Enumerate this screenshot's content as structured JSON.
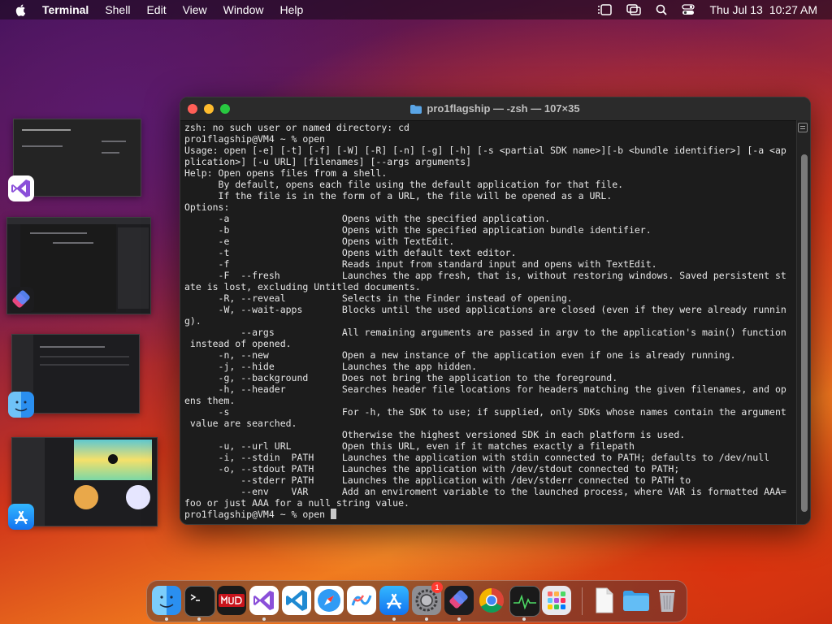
{
  "menubar": {
    "app_name": "Terminal",
    "items": [
      "Shell",
      "Edit",
      "View",
      "Window",
      "Help"
    ],
    "date": "Thu Jul 13",
    "time": "10:27 AM"
  },
  "terminal": {
    "title": "pro1flagship — -zsh — 107×35",
    "lines": [
      "zsh: no such user or named directory: cd",
      "pro1flagship@VM4 ~ % open",
      "Usage: open [-e] [-t] [-f] [-W] [-R] [-n] [-g] [-h] [-s <partial SDK name>][-b <bundle identifier>] [-a <ap",
      "plication>] [-u URL] [filenames] [--args arguments]",
      "Help: Open opens files from a shell.",
      "      By default, opens each file using the default application for that file.",
      "      If the file is in the form of a URL, the file will be opened as a URL.",
      "Options:",
      "      -a                    Opens with the specified application.",
      "      -b                    Opens with the specified application bundle identifier.",
      "      -e                    Opens with TextEdit.",
      "      -t                    Opens with default text editor.",
      "      -f                    Reads input from standard input and opens with TextEdit.",
      "      -F  --fresh           Launches the app fresh, that is, without restoring windows. Saved persistent st",
      "ate is lost, excluding Untitled documents.",
      "      -R, --reveal          Selects in the Finder instead of opening.",
      "      -W, --wait-apps       Blocks until the used applications are closed (even if they were already runnin",
      "g).",
      "          --args            All remaining arguments are passed in argv to the application's main() function",
      " instead of opened.",
      "      -n, --new             Open a new instance of the application even if one is already running.",
      "      -j, --hide            Launches the app hidden.",
      "      -g, --background      Does not bring the application to the foreground.",
      "      -h, --header          Searches header file locations for headers matching the given filenames, and op",
      "ens them.",
      "      -s                    For -h, the SDK to use; if supplied, only SDKs whose names contain the argument",
      " value are searched.",
      "                            Otherwise the highest versioned SDK in each platform is used.",
      "      -u, --url URL         Open this URL, even if it matches exactly a filepath",
      "      -i, --stdin  PATH     Launches the application with stdin connected to PATH; defaults to /dev/null",
      "      -o, --stdout PATH     Launches the application with /dev/stdout connected to PATH;",
      "          --stderr PATH     Launches the application with /dev/stderr connected to PATH to",
      "          --env    VAR      Add an enviroment variable to the launched process, where VAR is formatted AAA=",
      "foo or just AAA for a null string value."
    ],
    "prompt": "pro1flagship@VM4 ~ % open "
  },
  "dock": {
    "settings_badge": "1"
  },
  "colors": {
    "red": "#ff5f57",
    "yellow": "#febc2e",
    "green": "#28c840"
  }
}
